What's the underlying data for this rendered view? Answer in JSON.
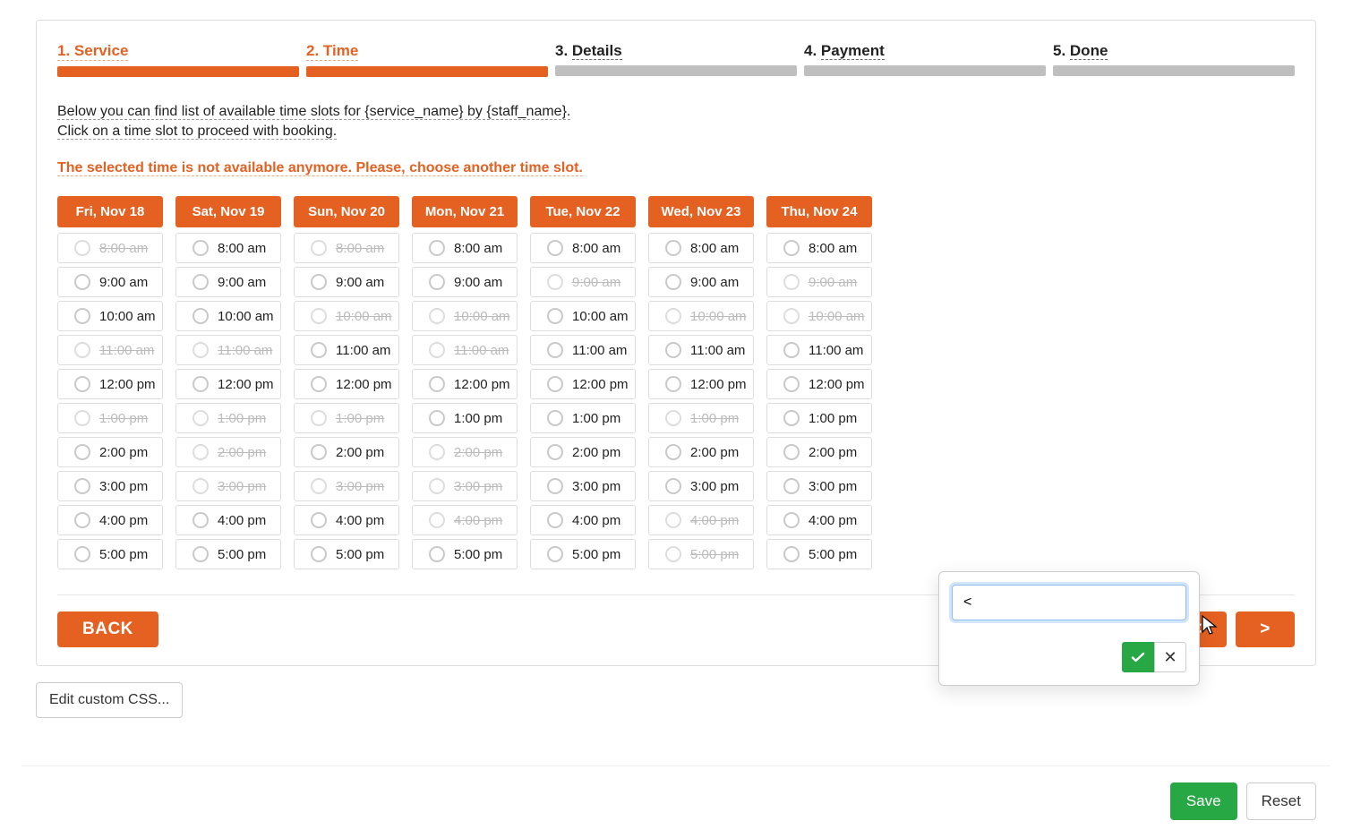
{
  "steps": [
    {
      "label": "1. Service",
      "done": true
    },
    {
      "label": "2. Time",
      "done": true
    },
    {
      "label": "3. Details",
      "done": false
    },
    {
      "label": "4. Payment",
      "done": false
    },
    {
      "label": "5. Done",
      "done": false
    }
  ],
  "intro_line1": "Below you can find list of available time slots for {service_name} by {staff_name}.",
  "intro_line2": "Click on a time slot to proceed with booking.",
  "warning": "The selected time is not available anymore. Please, choose another time slot.",
  "days": [
    {
      "label": "Fri, Nov 18",
      "slots": [
        {
          "time": "8:00 am",
          "available": false
        },
        {
          "time": "9:00 am",
          "available": true
        },
        {
          "time": "10:00 am",
          "available": true
        },
        {
          "time": "11:00 am",
          "available": false
        },
        {
          "time": "12:00 pm",
          "available": true
        },
        {
          "time": "1:00 pm",
          "available": false
        },
        {
          "time": "2:00 pm",
          "available": true
        },
        {
          "time": "3:00 pm",
          "available": true
        },
        {
          "time": "4:00 pm",
          "available": true
        },
        {
          "time": "5:00 pm",
          "available": true
        }
      ]
    },
    {
      "label": "Sat, Nov 19",
      "slots": [
        {
          "time": "8:00 am",
          "available": true
        },
        {
          "time": "9:00 am",
          "available": true
        },
        {
          "time": "10:00 am",
          "available": true
        },
        {
          "time": "11:00 am",
          "available": false
        },
        {
          "time": "12:00 pm",
          "available": true
        },
        {
          "time": "1:00 pm",
          "available": false
        },
        {
          "time": "2:00 pm",
          "available": false
        },
        {
          "time": "3:00 pm",
          "available": false
        },
        {
          "time": "4:00 pm",
          "available": true
        },
        {
          "time": "5:00 pm",
          "available": true
        }
      ]
    },
    {
      "label": "Sun, Nov 20",
      "slots": [
        {
          "time": "8:00 am",
          "available": false
        },
        {
          "time": "9:00 am",
          "available": true
        },
        {
          "time": "10:00 am",
          "available": false
        },
        {
          "time": "11:00 am",
          "available": true
        },
        {
          "time": "12:00 pm",
          "available": true
        },
        {
          "time": "1:00 pm",
          "available": false
        },
        {
          "time": "2:00 pm",
          "available": true
        },
        {
          "time": "3:00 pm",
          "available": false
        },
        {
          "time": "4:00 pm",
          "available": true
        },
        {
          "time": "5:00 pm",
          "available": true
        }
      ]
    },
    {
      "label": "Mon, Nov 21",
      "slots": [
        {
          "time": "8:00 am",
          "available": true
        },
        {
          "time": "9:00 am",
          "available": true
        },
        {
          "time": "10:00 am",
          "available": false
        },
        {
          "time": "11:00 am",
          "available": false
        },
        {
          "time": "12:00 pm",
          "available": true
        },
        {
          "time": "1:00 pm",
          "available": true
        },
        {
          "time": "2:00 pm",
          "available": false
        },
        {
          "time": "3:00 pm",
          "available": false
        },
        {
          "time": "4:00 pm",
          "available": false
        },
        {
          "time": "5:00 pm",
          "available": true
        }
      ]
    },
    {
      "label": "Tue, Nov 22",
      "slots": [
        {
          "time": "8:00 am",
          "available": true
        },
        {
          "time": "9:00 am",
          "available": false
        },
        {
          "time": "10:00 am",
          "available": true
        },
        {
          "time": "11:00 am",
          "available": true
        },
        {
          "time": "12:00 pm",
          "available": true
        },
        {
          "time": "1:00 pm",
          "available": true
        },
        {
          "time": "2:00 pm",
          "available": true
        },
        {
          "time": "3:00 pm",
          "available": true
        },
        {
          "time": "4:00 pm",
          "available": true
        },
        {
          "time": "5:00 pm",
          "available": true
        }
      ]
    },
    {
      "label": "Wed, Nov 23",
      "slots": [
        {
          "time": "8:00 am",
          "available": true
        },
        {
          "time": "9:00 am",
          "available": true
        },
        {
          "time": "10:00 am",
          "available": false
        },
        {
          "time": "11:00 am",
          "available": true
        },
        {
          "time": "12:00 pm",
          "available": true
        },
        {
          "time": "1:00 pm",
          "available": false
        },
        {
          "time": "2:00 pm",
          "available": true
        },
        {
          "time": "3:00 pm",
          "available": true
        },
        {
          "time": "4:00 pm",
          "available": false
        },
        {
          "time": "5:00 pm",
          "available": false
        }
      ]
    },
    {
      "label": "Thu, Nov 24",
      "slots": [
        {
          "time": "8:00 am",
          "available": true
        },
        {
          "time": "9:00 am",
          "available": false
        },
        {
          "time": "10:00 am",
          "available": false
        },
        {
          "time": "11:00 am",
          "available": true
        },
        {
          "time": "12:00 pm",
          "available": true
        },
        {
          "time": "1:00 pm",
          "available": true
        },
        {
          "time": "2:00 pm",
          "available": true
        },
        {
          "time": "3:00 pm",
          "available": true
        },
        {
          "time": "4:00 pm",
          "available": true
        },
        {
          "time": "5:00 pm",
          "available": true
        }
      ]
    }
  ],
  "back_label": "BACK",
  "prev_label": "<",
  "next_label": ">",
  "edit_css_label": "Edit custom CSS...",
  "popover": {
    "value": "<"
  },
  "footer": {
    "save": "Save",
    "reset": "Reset"
  }
}
